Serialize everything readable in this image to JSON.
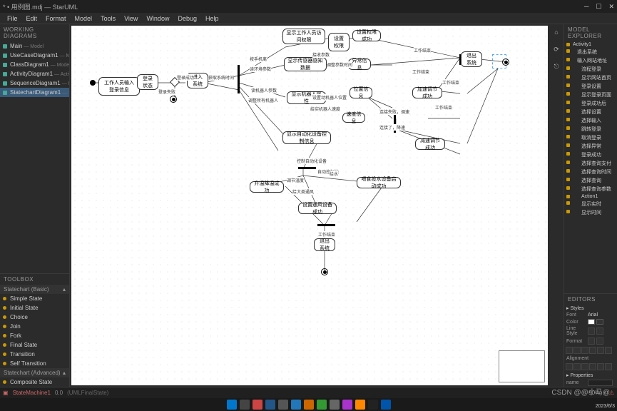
{
  "window": {
    "title": "* • 用例图.mdj — StarUML"
  },
  "menu": [
    "File",
    "Edit",
    "Format",
    "Model",
    "Tools",
    "View",
    "Window",
    "Debug",
    "Help"
  ],
  "panels": {
    "working_diagrams": {
      "title": "WORKING DIAGRAMS",
      "items": [
        {
          "name": "Main",
          "sub": "— Model"
        },
        {
          "name": "UseCaseDiagram1",
          "sub": "— Model"
        },
        {
          "name": "ClassDiagram1",
          "sub": "— Model"
        },
        {
          "name": "ActivityDiagram1",
          "sub": "— Activity1"
        },
        {
          "name": "SequenceDiagram1",
          "sub": "— Interact…"
        },
        {
          "name": "StatechartDiagram1",
          "sub": "— StateM…"
        }
      ],
      "active_index": 5
    },
    "toolbox": {
      "title": "TOOLBOX",
      "groups": [
        {
          "name": "Statechart (Basic)",
          "items": [
            "Simple State",
            "Initial State",
            "Choice",
            "Join",
            "Fork",
            "Final State",
            "Transition",
            "Self Transition"
          ]
        },
        {
          "name": "Statechart (Advanced)",
          "items": [
            "Composite State"
          ]
        }
      ]
    },
    "model_explorer": {
      "title": "MODEL EXPLORER",
      "root": "Activity1",
      "items": [
        "退出系统",
        "输入网站地址",
        "流程登录",
        "显示网站首页",
        "登录设置",
        "显示登录页面",
        "登录成功后",
        "选择设置",
        "选择输入",
        "跳转登录",
        "取消登录",
        "选择异常",
        "登录成功",
        "选择查询支付",
        "选择查询时间",
        "选择查询",
        "选择查询参数",
        "Action1",
        "显示实时",
        "显示时间"
      ]
    },
    "editors": {
      "title": "EDITORS",
      "styles_label": "Styles",
      "font_label": "Font",
      "font_value": "Arial",
      "color_label": "Color",
      "line_label": "Line Style",
      "format_label": "Format",
      "alignment_label": "Alignment",
      "properties_label": "Properties",
      "prop_name": "name"
    }
  },
  "nodes": {
    "n1": "工作人员输入登录信息",
    "n2": "登录状态",
    "n3": "进入系统",
    "n4": "显示工作人员访问权限",
    "n5": "设置权限",
    "n6": "设置权限成功",
    "n7": "显示传感器感知数据",
    "n8": "异常信息",
    "n9": "显示机器人属性",
    "n10": "位置信息",
    "n11": "加速调节成功",
    "n12": "速度信息",
    "n13": "显示自动化设备控制信息",
    "n14": "减速调节成功",
    "n15": "升温降温成功",
    "n16": "喂食投水设备启动成功",
    "n17": "设置通风设备成功",
    "n18": "退出系统",
    "n19": "退出系统"
  },
  "edge_labels": {
    "e1": "登录失败",
    "e2": "登录成功",
    "e3": "获取系统时间",
    "e4": "读环境参数",
    "e5": "读机器人参数",
    "e6": "调整所有机器人",
    "e7": "调整参数时间",
    "e8": "接收参数",
    "e9": "按手机离",
    "e10": "设置动机器人位置",
    "e11": "给实机器人速度",
    "e12": "连接失败，调速",
    "e13": "连接了，降速",
    "e14": "工作结束",
    "e15": "工作结束",
    "e16": "工作结束",
    "e17": "工作结束",
    "e18": "控制自动化设备",
    "e19": "自动控制类",
    "e20": "给水",
    "e21": "调节温度",
    "e22": "给大类通风",
    "e23": "工作结束"
  },
  "status": {
    "machine": "StateMachine1",
    "version": "0.0",
    "state": "(UMLFinalState)",
    "zoom": "90%"
  },
  "watermark": "CSDN @@小马@",
  "taskbar_time": "2023/6/3"
}
